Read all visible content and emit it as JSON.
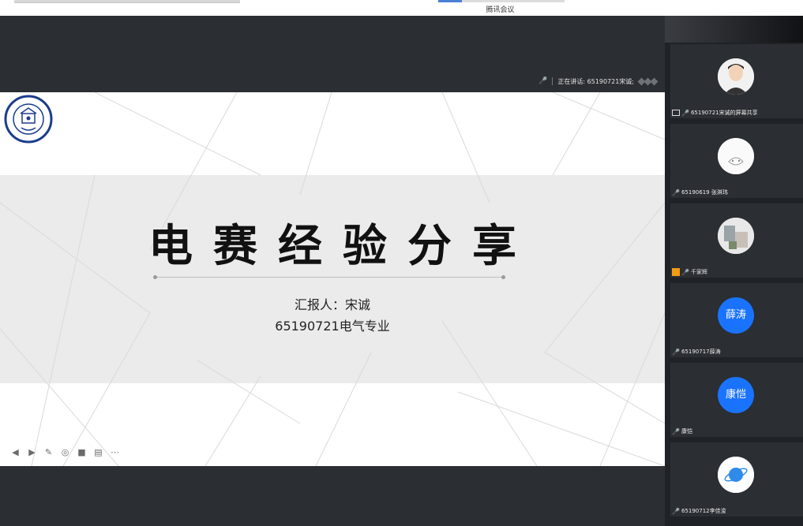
{
  "window": {
    "title": "腾讯会议"
  },
  "speaking": {
    "text": "正在讲话: 65190721宋诚;"
  },
  "slide": {
    "title": "电赛经验分享",
    "reporter": "汇报人：宋诚",
    "major": "65190721电气专业"
  },
  "slide_controls": [
    "prev-icon",
    "play-icon",
    "pen-icon",
    "focus-icon",
    "camera-icon",
    "subtitle-icon",
    "more-icon"
  ],
  "participants": [
    {
      "name": "65190721宋诚的屏幕共享",
      "avatar": "photo-male"
    },
    {
      "name": "65190619 张淋玮",
      "avatar": "cat-sketch"
    },
    {
      "name": "千家辉",
      "avatar": "photo-blur"
    },
    {
      "name": "65190717薛涛",
      "avatar_text": "薛涛"
    },
    {
      "name": "康恺",
      "avatar_text": "康恺"
    },
    {
      "name": "65190712李佳浚",
      "avatar": "planet"
    }
  ],
  "colors": {
    "accent": "#1a73ff",
    "panel": "#2b2e33",
    "bg": "#1f2226"
  }
}
